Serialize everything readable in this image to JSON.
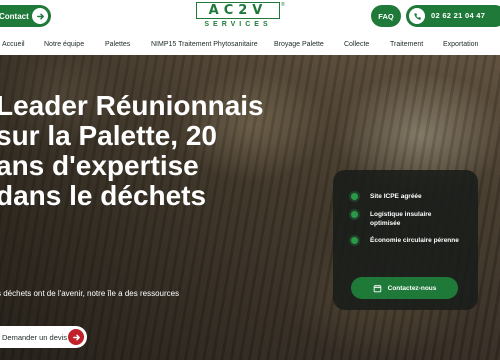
{
  "header": {
    "contact_label": "Contact",
    "logo_mark": "AC2V",
    "logo_tm": "®",
    "logo_sub": "SERVICES",
    "faq_label": "FAQ",
    "phone": "02 62 21 04 47"
  },
  "nav": {
    "items": [
      {
        "label": "Accueil"
      },
      {
        "label": "Notre équipe"
      },
      {
        "label": "Palettes"
      },
      {
        "label": "NIMP15 Traitement Phytosanitaire"
      },
      {
        "label": "Broyage Palette"
      },
      {
        "label": "Collecte"
      },
      {
        "label": "Traitement"
      },
      {
        "label": "Exportation"
      }
    ]
  },
  "hero": {
    "headline_lines": [
      "Leader Réunionnais",
      "sur la Palette, 20",
      "ans d'expertise",
      "dans le déchets"
    ],
    "tagline": "s déchets ont de l'avenir, notre île a des ressources",
    "cta_label": "Demander un devis"
  },
  "card": {
    "features": [
      {
        "label": "Site ICPE agréée"
      },
      {
        "label": "Logistique insulaire optimisée"
      },
      {
        "label": "Économie circulaire pérenne"
      }
    ],
    "cta_label": "Contactez-nous"
  },
  "colors": {
    "brand_green": "#1f7a3a",
    "accent_red": "#c0212b",
    "card_bg": "#191c1a"
  },
  "icons": {
    "contact_arrow": "arrow-right-icon",
    "phone": "phone-icon",
    "devis_arrow": "arrow-right-icon",
    "calendar": "calendar-icon",
    "feature_bullet": "dot-icon"
  }
}
